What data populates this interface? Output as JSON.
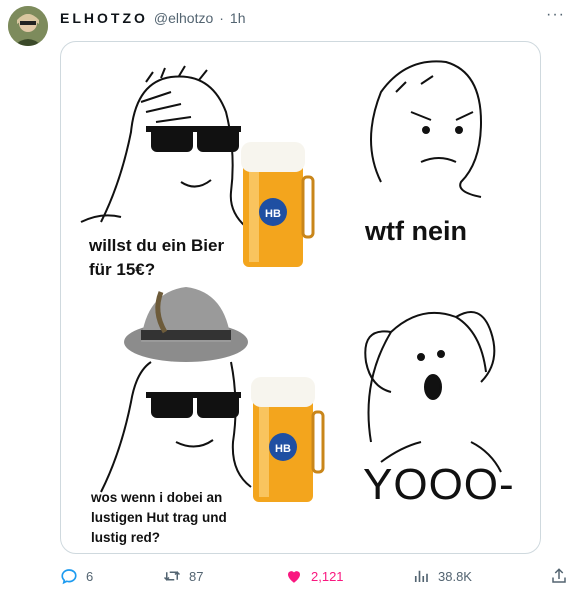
{
  "post": {
    "author_name": "ELHOTZO",
    "author_handle": "@elhotzo",
    "separator": "·",
    "time": "1h",
    "more_label": "···"
  },
  "meme": {
    "panel1_text": "willst du ein Bier\nfür 15€?",
    "panel2_text": "wtf nein",
    "panel3_text": "wos wenn i dobei an\nlustigen Hut trag und\nlustig red?",
    "panel4_text": "YOOO-",
    "mug_logo": "HB"
  },
  "actions": {
    "replies": "6",
    "reposts": "87",
    "likes": "2,121",
    "views": "38.8K"
  },
  "icons": {
    "reply": "reply-icon",
    "repost": "repost-icon",
    "like": "heart-icon",
    "views": "views-icon",
    "share": "share-icon"
  },
  "colors": {
    "like_active": "#f91880",
    "muted": "#536471",
    "border": "#cfd9de"
  }
}
